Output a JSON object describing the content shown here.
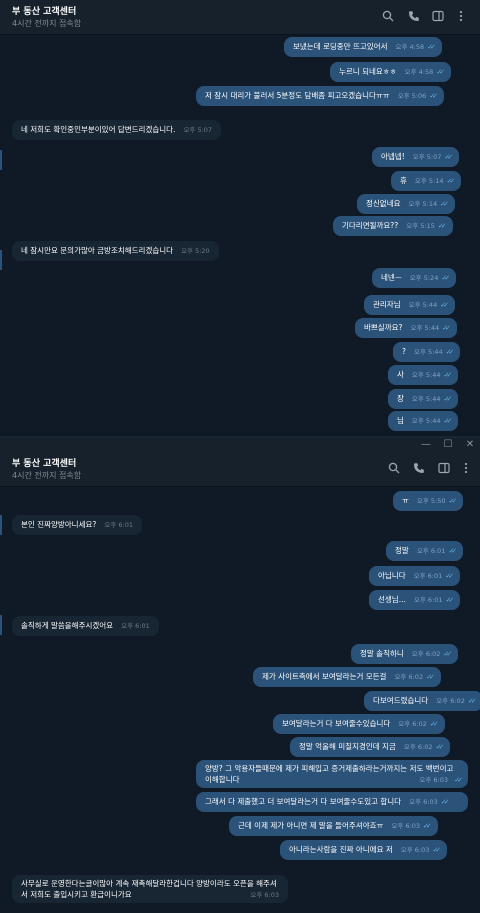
{
  "header": {
    "title": "부 동산 고객센터",
    "subtitle": "4시간 전까지 접속함"
  },
  "icons": {
    "search": "search-icon",
    "call": "phone-icon",
    "sidebar": "sidebar-toggle-icon",
    "menu": "more-vertical-icon"
  },
  "window": {
    "minimize": "—",
    "maximize": "☐",
    "close": "✕"
  },
  "panel1": {
    "messages": [
      {
        "dir": "out",
        "text": "보냈는데 로딩중만 뜨고있어서",
        "time": "오후 4:58"
      },
      {
        "dir": "out",
        "text": "누르니 되네요ㅎㅎ",
        "time": "오후 4:58"
      },
      {
        "dir": "out",
        "text": "저 잠시 대리가 불러서 5분정도 담배좀 피고오겠습니다ㅠㅠ",
        "time": "오후 5:06"
      },
      {
        "dir": "in",
        "text": "네 저희도 확인중인부분이있어 답변드리겠습니다.",
        "time": "오후 5:07"
      },
      {
        "dir": "out",
        "text": "아넵넵!",
        "time": "오후 5:07"
      },
      {
        "dir": "out",
        "text": "휴",
        "time": "오후 5:14"
      },
      {
        "dir": "out",
        "text": "정신없네요",
        "time": "오후 5:14"
      },
      {
        "dir": "out",
        "text": "기다리면될까요??",
        "time": "오후 5:15"
      },
      {
        "dir": "in",
        "text": "네 잠시만요 문의가많아 금방조치해드리겠습니다",
        "time": "오후 5:20"
      },
      {
        "dir": "out",
        "text": "네넨ㅡ",
        "time": "오후 5:24"
      },
      {
        "dir": "out",
        "text": "관리자님",
        "time": "오후 5:44"
      },
      {
        "dir": "out",
        "text": "바쁘실까요?",
        "time": "오후 5:44"
      },
      {
        "dir": "out",
        "text": "?",
        "time": "오후 5:44"
      },
      {
        "dir": "out",
        "text": "사",
        "time": "오후 5:44"
      },
      {
        "dir": "out",
        "text": "장",
        "time": "오후 5:44"
      },
      {
        "dir": "out",
        "text": "님",
        "time": "오후 5:44"
      }
    ]
  },
  "panel2": {
    "messages": [
      {
        "dir": "out",
        "text": "ㅠ",
        "time": "오후 5:50"
      },
      {
        "dir": "in",
        "text": "본인 진짜양방아니세요?",
        "time": "오후 6:01"
      },
      {
        "dir": "out",
        "text": "정말",
        "time": "오후 6:01"
      },
      {
        "dir": "out",
        "text": "아닙니다",
        "time": "오후 6:01"
      },
      {
        "dir": "out",
        "text": "선생님...",
        "time": "오후 6:01"
      },
      {
        "dir": "in",
        "text": "솔직하게 말씀을해주시겠어요",
        "time": "오후 6:01"
      },
      {
        "dir": "out",
        "text": "정말 솔직하니",
        "time": "오후 6:02"
      },
      {
        "dir": "out",
        "text": "제가 사이트측에서 보여달라는거 모든걸",
        "time": "오후 6:02"
      },
      {
        "dir": "out",
        "text": "다보여드렸습니다",
        "time": "오후 6:02"
      },
      {
        "dir": "out",
        "text": "보여달라는거 다 보여줄수있습니다",
        "time": "오후 6:02"
      },
      {
        "dir": "out",
        "text": "정말 억울해 미칠지경인데 지금",
        "time": "오후 6:02"
      },
      {
        "dir": "out",
        "text": "양방? 그 악용자들때문에 제가 피해입고 증거제출하라는거까지는 저도 백번이고이해합니다",
        "time": "오후 6:03"
      },
      {
        "dir": "out",
        "text": "그래서 다 제출했고 더 보여달라는거 다 보여줄수도있고 합니다",
        "time": "오후 6:03"
      },
      {
        "dir": "out",
        "text": "근데 이제 제가 아니면 제 말을 들어주셔야죠ㅠ",
        "time": "오후 6:03"
      },
      {
        "dir": "out",
        "text": "아니라는사람을 진짜 아니에요 저",
        "time": "오후 6:03"
      },
      {
        "dir": "in",
        "text": "사무실로 운영한다는글이많아 계속 재촉해달라한겁니다 양방이라도 오픈을 해주셔서 저희도 출입시키고 환급이니가요",
        "time": "오후 6:03"
      }
    ]
  }
}
